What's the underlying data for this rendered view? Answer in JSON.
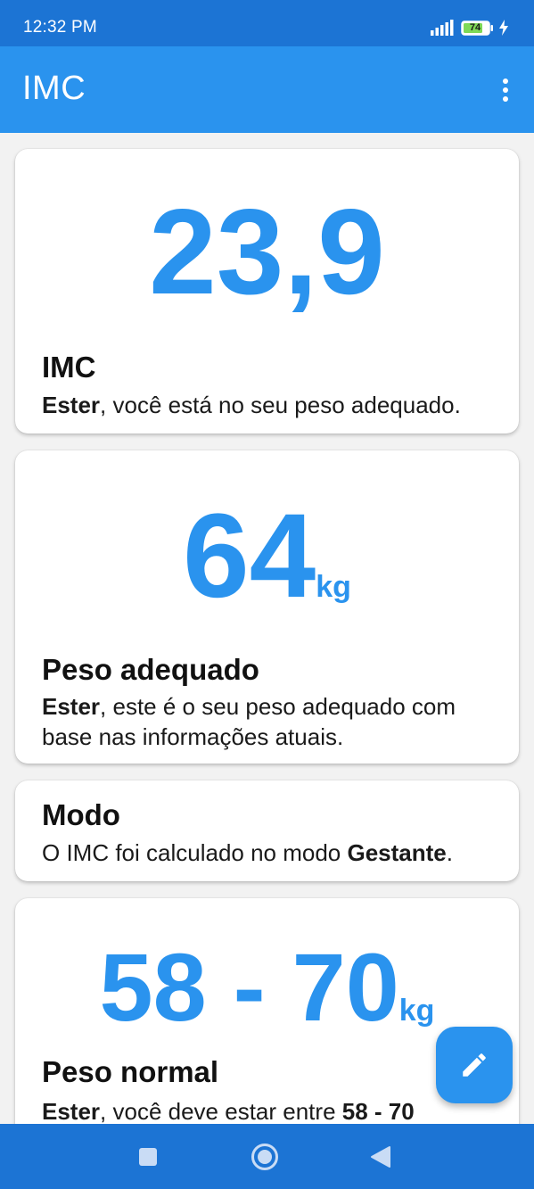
{
  "status_bar": {
    "time": "12:32 PM",
    "battery": "74"
  },
  "app_bar": {
    "title": "IMC"
  },
  "imc_card": {
    "value": "23,9",
    "title": "IMC",
    "name": "Ester",
    "message": ", você está no seu peso adequado."
  },
  "weight_card": {
    "value": "64",
    "unit": "kg",
    "title": "Peso adequado",
    "name": "Ester",
    "message": ", este é o seu peso adequado com base nas informações atuais."
  },
  "mode_card": {
    "title": "Modo",
    "text_before": "O IMC foi calculado no modo ",
    "mode": "Gestante",
    "text_after": "."
  },
  "normal_card": {
    "value": "58 - 70",
    "unit": "kg",
    "title": "Peso normal",
    "name": "Ester",
    "message": ", você deve estar entre ",
    "range": "58 - 70"
  },
  "colors": {
    "status_bar": "#1c74d4",
    "app_bar": "#2a93ee",
    "accent": "#2a93ee",
    "background": "#f2f2f2"
  },
  "icons": [
    "signal-icon",
    "battery-icon",
    "bolt-icon",
    "more-vert-icon",
    "edit-pencil-icon",
    "recents-square-icon",
    "home-circle-icon",
    "back-triangle-icon"
  ]
}
